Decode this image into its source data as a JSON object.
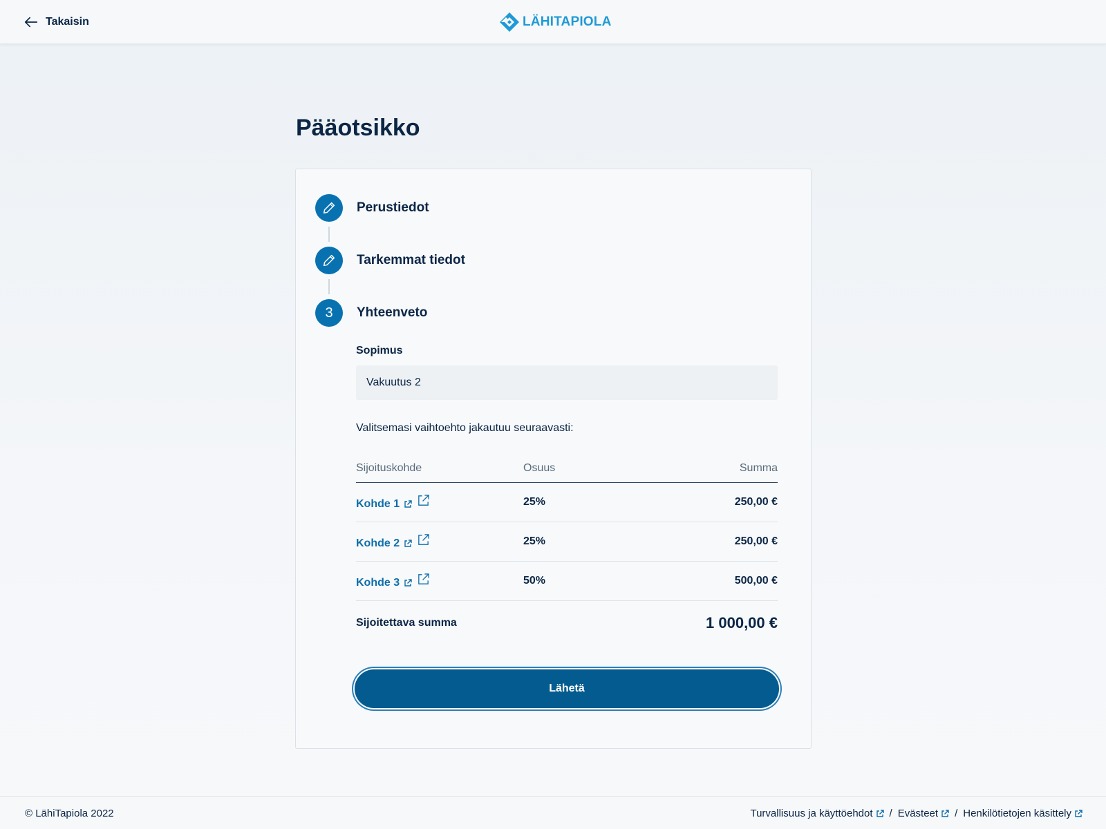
{
  "header": {
    "back_label": "Takaisin",
    "logo_text": "LÄHITAPIOLA",
    "logo_color": "#1f9ad6"
  },
  "page": {
    "title": "Pääotsikko"
  },
  "steps": [
    {
      "label": "Perustiedot",
      "icon": "pencil-icon"
    },
    {
      "label": "Tarkemmat tiedot",
      "icon": "pencil-icon"
    },
    {
      "label": "Yhteenveto",
      "number": "3"
    }
  ],
  "contract": {
    "label": "Sopimus",
    "value": "Vakuutus 2"
  },
  "intro_text": "Valitsemasi vaihtoehto jakautuu seuraavasti:",
  "table": {
    "headers": [
      "Sijoituskohde",
      "Osuus",
      "Summa"
    ],
    "rows": [
      {
        "target": "Kohde 1",
        "share": "25%",
        "amount": "250,00 €"
      },
      {
        "target": "Kohde 2",
        "share": "25%",
        "amount": "250,00 €"
      },
      {
        "target": "Kohde 3",
        "share": "50%",
        "amount": "500,00 €"
      }
    ],
    "total_label": "Sijoitettava summa",
    "total_value": "1 000,00 €"
  },
  "submit_label": "Lähetä",
  "footer": {
    "copyright": "© LähiTapiola 2022",
    "links": [
      "Turvallisuus ja käyttöehdot",
      "Evästeet",
      "Henkilötietojen käsittely"
    ],
    "separator": "/"
  },
  "colors": {
    "primary": "#0872b0",
    "button": "#045b8f",
    "text": "#0b2545",
    "link": "#0e6eaa"
  }
}
